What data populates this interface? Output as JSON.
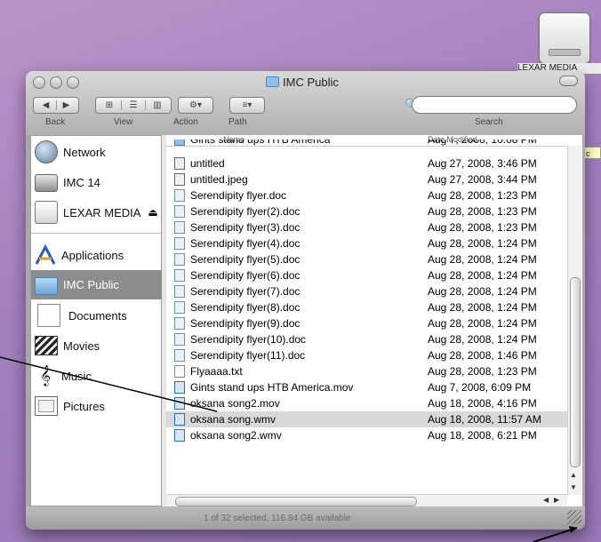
{
  "desktop": {
    "drive_label": "LEXAR MEDIA",
    "help_tag": "c"
  },
  "window": {
    "title": "IMC Public",
    "toolbar": {
      "back_label": "Back",
      "view_label": "View",
      "action_label": "Action",
      "path_label": "Path",
      "search_label": "Search",
      "search_value": "",
      "search_placeholder": ""
    },
    "sidebar": {
      "items": [
        {
          "label": "Network",
          "icon": "network-icon"
        },
        {
          "label": "IMC 14",
          "icon": "hard-drive-icon"
        },
        {
          "label": "LEXAR MEDIA",
          "icon": "external-drive-icon",
          "eject": "⏏"
        },
        {
          "label": "Applications",
          "icon": "applications-icon"
        },
        {
          "label": "IMC Public",
          "icon": "folder-icon",
          "selected": true
        },
        {
          "label": "Documents",
          "icon": "documents-icon"
        },
        {
          "label": "Movies",
          "icon": "movies-icon"
        },
        {
          "label": "Music",
          "icon": "music-icon"
        },
        {
          "label": "Pictures",
          "icon": "pictures-icon"
        }
      ]
    },
    "columns": {
      "name": "Name",
      "date_modified": "Date Modified"
    },
    "files": [
      {
        "name": "Gints stand ups HTB America",
        "date": "Aug 7, 2008, 10:08 PM",
        "icon": "folder-icon",
        "selected": false
      },
      {
        "name": "untitled",
        "date": "Aug 27, 2008, 3:46 PM",
        "icon": "image-file-icon",
        "selected": false
      },
      {
        "name": "untitled.jpeg",
        "date": "Aug 27, 2008, 3:44 PM",
        "icon": "image-file-icon",
        "selected": false
      },
      {
        "name": "Serendipity flyer.doc",
        "date": "Aug 28, 2008, 1:23 PM",
        "icon": "doc-file-icon",
        "selected": false
      },
      {
        "name": "Serendipity flyer(2).doc",
        "date": "Aug 28, 2008, 1:23 PM",
        "icon": "doc-file-icon",
        "selected": false
      },
      {
        "name": "Serendipity flyer(3).doc",
        "date": "Aug 28, 2008, 1:23 PM",
        "icon": "doc-file-icon",
        "selected": false
      },
      {
        "name": "Serendipity flyer(4).doc",
        "date": "Aug 28, 2008, 1:24 PM",
        "icon": "doc-file-icon",
        "selected": false
      },
      {
        "name": "Serendipity flyer(5).doc",
        "date": "Aug 28, 2008, 1:24 PM",
        "icon": "doc-file-icon",
        "selected": false
      },
      {
        "name": "Serendipity flyer(6).doc",
        "date": "Aug 28, 2008, 1:24 PM",
        "icon": "doc-file-icon",
        "selected": false
      },
      {
        "name": "Serendipity flyer(7).doc",
        "date": "Aug 28, 2008, 1:24 PM",
        "icon": "doc-file-icon",
        "selected": false
      },
      {
        "name": "Serendipity flyer(8).doc",
        "date": "Aug 28, 2008, 1:24 PM",
        "icon": "doc-file-icon",
        "selected": false
      },
      {
        "name": "Serendipity flyer(9).doc",
        "date": "Aug 28, 2008, 1:24 PM",
        "icon": "doc-file-icon",
        "selected": false
      },
      {
        "name": "Serendipity flyer(10).doc",
        "date": "Aug 28, 2008, 1:24 PM",
        "icon": "doc-file-icon",
        "selected": false
      },
      {
        "name": "Serendipity flyer(11).doc",
        "date": "Aug 28, 2008, 1:46 PM",
        "icon": "doc-file-icon",
        "selected": false
      },
      {
        "name": "Flyaaaa.txt",
        "date": "Aug 28, 2008, 1:23 PM",
        "icon": "text-file-icon",
        "selected": false
      },
      {
        "name": "Gints stand ups HTB America.mov",
        "date": "Aug 7, 2008, 6:09 PM",
        "icon": "movie-file-icon",
        "selected": false
      },
      {
        "name": "oksana song2.mov",
        "date": "Aug 18, 2008, 4:16 PM",
        "icon": "movie-file-icon",
        "selected": false
      },
      {
        "name": "oksana song.wmv",
        "date": "Aug 18, 2008, 11:57 AM",
        "icon": "movie-file-icon",
        "selected": true
      },
      {
        "name": "oksana song2.wmv",
        "date": "Aug 18, 2008, 6:21 PM",
        "icon": "movie-file-icon",
        "selected": false
      }
    ],
    "status": "1 of 32 selected, 116.84 GB available"
  }
}
